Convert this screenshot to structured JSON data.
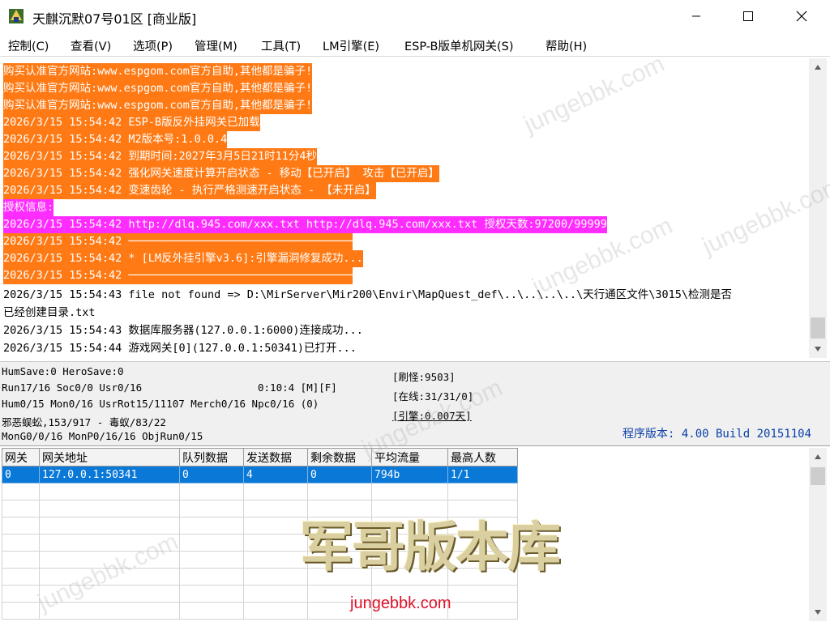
{
  "window": {
    "title": "天麒沉默07号01区 [商业版]",
    "icons": {
      "app": "app-icon",
      "minimize": "minimize-icon",
      "maximize": "maximize-icon",
      "close": "close-icon"
    }
  },
  "menu": {
    "items": [
      "控制(C)",
      "查看(V)",
      "选项(P)",
      "管理(M)",
      "工具(T)",
      "LM引擎(E)",
      "ESP-B版单机网关(S)",
      "帮助(H)"
    ]
  },
  "log": {
    "lines": [
      {
        "text": "购买认准官方网站:www.espgom.com官方自助,其他都是骗子!",
        "style": "orange"
      },
      {
        "text": "购买认准官方网站:www.espgom.com官方自助,其他都是骗子!",
        "style": "orange"
      },
      {
        "text": "购买认准官方网站:www.espgom.com官方自助,其他都是骗子!",
        "style": "orange"
      },
      {
        "text": "2026/3/15 15:54:42 ESP-B版反外挂网关已加载",
        "style": "orange"
      },
      {
        "text": "2026/3/15 15:54:42 M2版本号:1.0.0.4",
        "style": "orange"
      },
      {
        "text": "2026/3/15 15:54:42 到期时间:2027年3月5日21时11分4秒",
        "style": "orange"
      },
      {
        "text": "2026/3/15 15:54:42 强化网关速度计算开启状态 - 移动【已开启】 攻击【已开启】",
        "style": "orange"
      },
      {
        "text": "2026/3/15 15:54:42 变速齿轮 - 执行严格测速开启状态 - 【未开启】",
        "style": "orange"
      },
      {
        "text": "授权信息:",
        "style": "magenta"
      },
      {
        "text": "2026/3/15 15:54:42 http://dlq.945.com/xxx.txt http://dlq.945.com/xxx.txt 授权天数:97200/99999",
        "style": "magenta"
      },
      {
        "text": "2026/3/15 15:54:42 ──────────────────────────────────",
        "style": "orange"
      },
      {
        "text": "2026/3/15 15:54:42 * [LM反外挂引擎v3.6]:引擎漏洞修复成功...",
        "style": "orange"
      },
      {
        "text": "2026/3/15 15:54:42 ──────────────────────────────────",
        "style": "orange"
      },
      {
        "text": "2026/3/15 15:54:43 file not found => D:\\MirServer\\Mir200\\Envir\\MapQuest_def\\..\\..\\..\\..\\天行通区文件\\3015\\检测是否",
        "style": "plain"
      },
      {
        "text": "已经创建目录.txt",
        "style": "plain"
      },
      {
        "text": "2026/3/15 15:54:43 数据库服务器(127.0.0.1:6000)连接成功...",
        "style": "plain"
      },
      {
        "text": "2026/3/15 15:54:44 游戏网关[0](127.0.0.1:50341)已打开...",
        "style": "plain"
      }
    ]
  },
  "status": {
    "line1": "HumSave:0 HeroSave:0",
    "line2": "Run17/16 Soc0/0 Usr0/16",
    "timer": "0:10:4 [M][F]",
    "line3": "Hum0/15 Mon0/16 UsrRot15/11107 Merch0/16 Npc0/16 (0)",
    "line4": "邪恶蜈蚣,153/917 - 毒蚁/83/22",
    "line5": "MonG0/0/16 MonP0/16/16 ObjRun0/15",
    "refresh": "[刷怪:9503]",
    "online": "[在线:31/31/0]",
    "engine": "[引擎:0.007天]",
    "version": "程序版本: 4.00 Build 20151104"
  },
  "table": {
    "headers": [
      "网关",
      "网关地址",
      "队列数据",
      "发送数据",
      "剩余数据",
      "平均流量",
      "最高人数"
    ],
    "rows": [
      [
        "0",
        "127.0.0.1:50341",
        "0",
        "4",
        "0",
        "794b",
        "1/1"
      ]
    ]
  },
  "watermark": {
    "site": "jungebbk.com",
    "logo": "军哥版本库"
  },
  "colors": {
    "log_orange": "#ff7a14",
    "log_magenta": "#ff2cff",
    "selection": "#0a78d7",
    "version_text": "#0a3fa8"
  }
}
